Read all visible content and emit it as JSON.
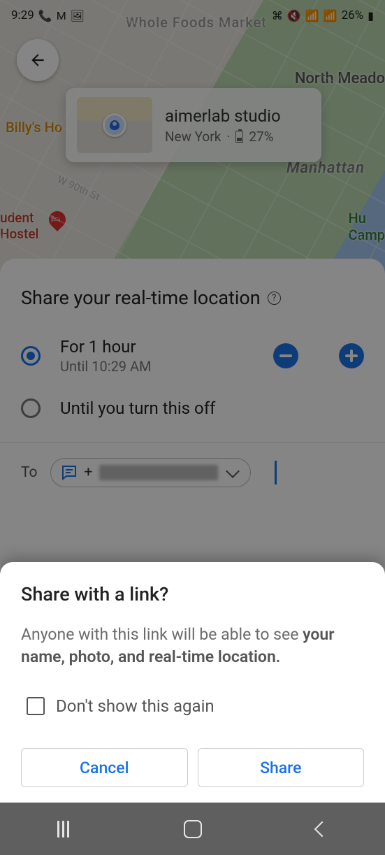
{
  "status_bar": {
    "time": "9:29",
    "battery": "26%"
  },
  "map_labels": {
    "whole_foods": "Whole Foods Market",
    "north_meadow": "North Meado",
    "billys": "Billy's Ho",
    "manhattan": "Manhattan",
    "w90": "W 90th St",
    "hostel": "udent\nHostel",
    "camp": "Hu\nCamp"
  },
  "info_card": {
    "title": "aimerlab studio",
    "city": "New York",
    "battery": "27%"
  },
  "share_panel": {
    "title": "Share your real-time location",
    "options": [
      {
        "title": "For 1 hour",
        "sub": "Until 10:29 AM",
        "selected": true
      },
      {
        "title": "Until you turn this off",
        "sub": "",
        "selected": false
      }
    ],
    "to_label": "To",
    "chip_prefix": "+"
  },
  "dialog": {
    "title": "Share with a link?",
    "body_plain": "Anyone with this link will be able to see ",
    "body_bold": "your name, photo, and real-time location.",
    "checkbox": "Don't show this again",
    "cancel": "Cancel",
    "share": "Share"
  }
}
